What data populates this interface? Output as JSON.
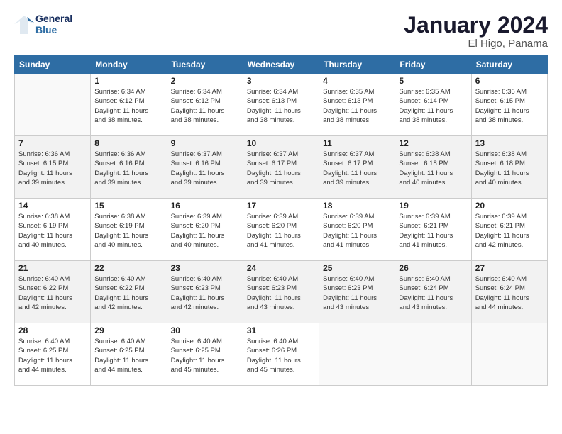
{
  "header": {
    "logo_line1": "General",
    "logo_line2": "Blue",
    "month": "January 2024",
    "location": "El Higo, Panama"
  },
  "weekdays": [
    "Sunday",
    "Monday",
    "Tuesday",
    "Wednesday",
    "Thursday",
    "Friday",
    "Saturday"
  ],
  "weeks": [
    [
      {
        "day": "",
        "info": ""
      },
      {
        "day": "1",
        "info": "Sunrise: 6:34 AM\nSunset: 6:12 PM\nDaylight: 11 hours\nand 38 minutes."
      },
      {
        "day": "2",
        "info": "Sunrise: 6:34 AM\nSunset: 6:12 PM\nDaylight: 11 hours\nand 38 minutes."
      },
      {
        "day": "3",
        "info": "Sunrise: 6:34 AM\nSunset: 6:13 PM\nDaylight: 11 hours\nand 38 minutes."
      },
      {
        "day": "4",
        "info": "Sunrise: 6:35 AM\nSunset: 6:13 PM\nDaylight: 11 hours\nand 38 minutes."
      },
      {
        "day": "5",
        "info": "Sunrise: 6:35 AM\nSunset: 6:14 PM\nDaylight: 11 hours\nand 38 minutes."
      },
      {
        "day": "6",
        "info": "Sunrise: 6:36 AM\nSunset: 6:15 PM\nDaylight: 11 hours\nand 38 minutes."
      }
    ],
    [
      {
        "day": "7",
        "info": "Sunrise: 6:36 AM\nSunset: 6:15 PM\nDaylight: 11 hours\nand 39 minutes."
      },
      {
        "day": "8",
        "info": "Sunrise: 6:36 AM\nSunset: 6:16 PM\nDaylight: 11 hours\nand 39 minutes."
      },
      {
        "day": "9",
        "info": "Sunrise: 6:37 AM\nSunset: 6:16 PM\nDaylight: 11 hours\nand 39 minutes."
      },
      {
        "day": "10",
        "info": "Sunrise: 6:37 AM\nSunset: 6:17 PM\nDaylight: 11 hours\nand 39 minutes."
      },
      {
        "day": "11",
        "info": "Sunrise: 6:37 AM\nSunset: 6:17 PM\nDaylight: 11 hours\nand 39 minutes."
      },
      {
        "day": "12",
        "info": "Sunrise: 6:38 AM\nSunset: 6:18 PM\nDaylight: 11 hours\nand 40 minutes."
      },
      {
        "day": "13",
        "info": "Sunrise: 6:38 AM\nSunset: 6:18 PM\nDaylight: 11 hours\nand 40 minutes."
      }
    ],
    [
      {
        "day": "14",
        "info": "Sunrise: 6:38 AM\nSunset: 6:19 PM\nDaylight: 11 hours\nand 40 minutes."
      },
      {
        "day": "15",
        "info": "Sunrise: 6:38 AM\nSunset: 6:19 PM\nDaylight: 11 hours\nand 40 minutes."
      },
      {
        "day": "16",
        "info": "Sunrise: 6:39 AM\nSunset: 6:20 PM\nDaylight: 11 hours\nand 40 minutes."
      },
      {
        "day": "17",
        "info": "Sunrise: 6:39 AM\nSunset: 6:20 PM\nDaylight: 11 hours\nand 41 minutes."
      },
      {
        "day": "18",
        "info": "Sunrise: 6:39 AM\nSunset: 6:20 PM\nDaylight: 11 hours\nand 41 minutes."
      },
      {
        "day": "19",
        "info": "Sunrise: 6:39 AM\nSunset: 6:21 PM\nDaylight: 11 hours\nand 41 minutes."
      },
      {
        "day": "20",
        "info": "Sunrise: 6:39 AM\nSunset: 6:21 PM\nDaylight: 11 hours\nand 42 minutes."
      }
    ],
    [
      {
        "day": "21",
        "info": "Sunrise: 6:40 AM\nSunset: 6:22 PM\nDaylight: 11 hours\nand 42 minutes."
      },
      {
        "day": "22",
        "info": "Sunrise: 6:40 AM\nSunset: 6:22 PM\nDaylight: 11 hours\nand 42 minutes."
      },
      {
        "day": "23",
        "info": "Sunrise: 6:40 AM\nSunset: 6:23 PM\nDaylight: 11 hours\nand 42 minutes."
      },
      {
        "day": "24",
        "info": "Sunrise: 6:40 AM\nSunset: 6:23 PM\nDaylight: 11 hours\nand 43 minutes."
      },
      {
        "day": "25",
        "info": "Sunrise: 6:40 AM\nSunset: 6:23 PM\nDaylight: 11 hours\nand 43 minutes."
      },
      {
        "day": "26",
        "info": "Sunrise: 6:40 AM\nSunset: 6:24 PM\nDaylight: 11 hours\nand 43 minutes."
      },
      {
        "day": "27",
        "info": "Sunrise: 6:40 AM\nSunset: 6:24 PM\nDaylight: 11 hours\nand 44 minutes."
      }
    ],
    [
      {
        "day": "28",
        "info": "Sunrise: 6:40 AM\nSunset: 6:25 PM\nDaylight: 11 hours\nand 44 minutes."
      },
      {
        "day": "29",
        "info": "Sunrise: 6:40 AM\nSunset: 6:25 PM\nDaylight: 11 hours\nand 44 minutes."
      },
      {
        "day": "30",
        "info": "Sunrise: 6:40 AM\nSunset: 6:25 PM\nDaylight: 11 hours\nand 45 minutes."
      },
      {
        "day": "31",
        "info": "Sunrise: 6:40 AM\nSunset: 6:26 PM\nDaylight: 11 hours\nand 45 minutes."
      },
      {
        "day": "",
        "info": ""
      },
      {
        "day": "",
        "info": ""
      },
      {
        "day": "",
        "info": ""
      }
    ]
  ]
}
